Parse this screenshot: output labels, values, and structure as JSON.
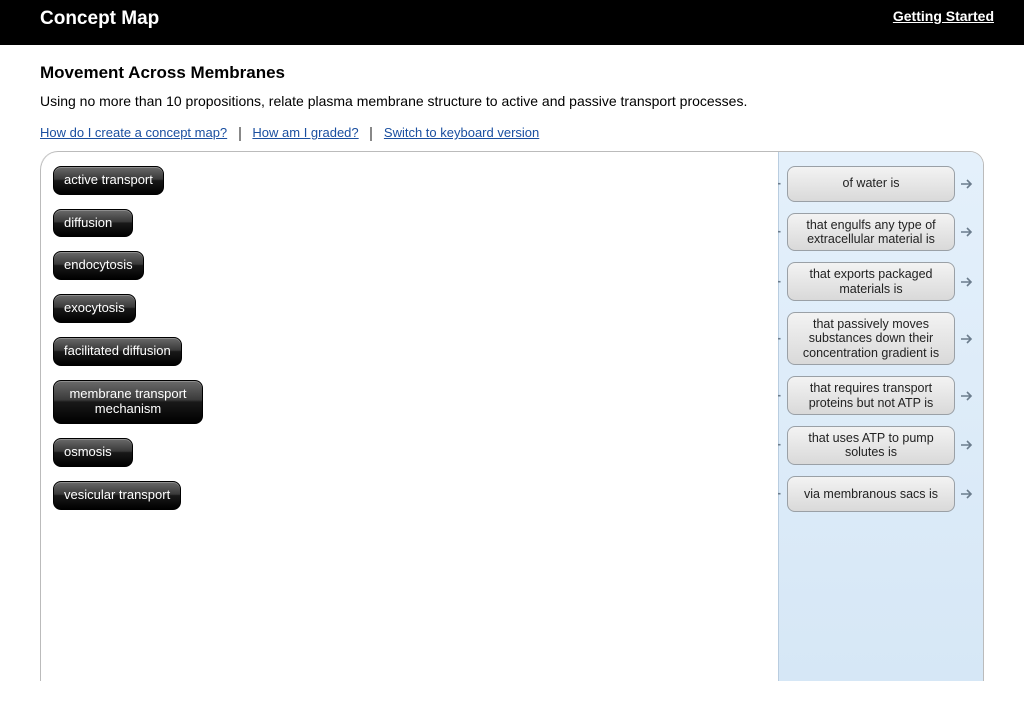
{
  "header": {
    "title": "Concept Map",
    "getting_started": "Getting Started"
  },
  "page": {
    "subtitle": "Movement Across Membranes",
    "instructions": "Using no more than 10 propositions, relate plasma membrane structure to active and passive transport processes."
  },
  "help_links": {
    "create": "How do I create a concept map?",
    "graded": "How am I graded?",
    "keyboard": "Switch to keyboard version"
  },
  "terms": [
    "active transport",
    "diffusion",
    "endocytosis",
    "exocytosis",
    "facilitated diffusion",
    "membrane transport mechanism",
    "osmosis",
    "vesicular transport"
  ],
  "slots": [
    "of water is",
    "that engulfs any type of extracellular material is",
    "that exports packaged materials is",
    "that passively moves substances down their concentration gradient is",
    "that requires transport proteins but not ATP is",
    "that uses ATP to pump solutes is",
    "via membranous sacs is"
  ]
}
